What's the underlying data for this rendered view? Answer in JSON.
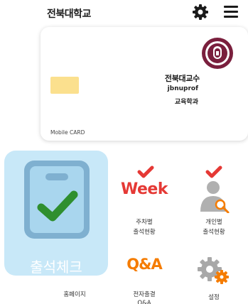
{
  "header": {
    "title": "전북대학교"
  },
  "card": {
    "label": "Mobile CARD",
    "name": "전북대교수",
    "user_id": "jbnuprof",
    "department": "교육학과"
  },
  "tiles": {
    "attendance_check": "출석체크",
    "weekly_status": {
      "line1": "주차별",
      "line2": "출석현황"
    },
    "personal_status": {
      "line1": "개인별",
      "line2": "출석현황"
    },
    "homepage": "홈페이지",
    "e_attendance_qa": {
      "line1": "전자출결",
      "line2": "Q&A"
    },
    "settings": "설정"
  },
  "icon_text": {
    "week": "Week",
    "qa": "Q&A"
  },
  "colors": {
    "check_tile_bg": "#c8e8f8",
    "card_chip": "#fbe08e",
    "check_green": "#2f8f2f",
    "week_red": "#e53935",
    "qa_orange": "#f57c00"
  }
}
